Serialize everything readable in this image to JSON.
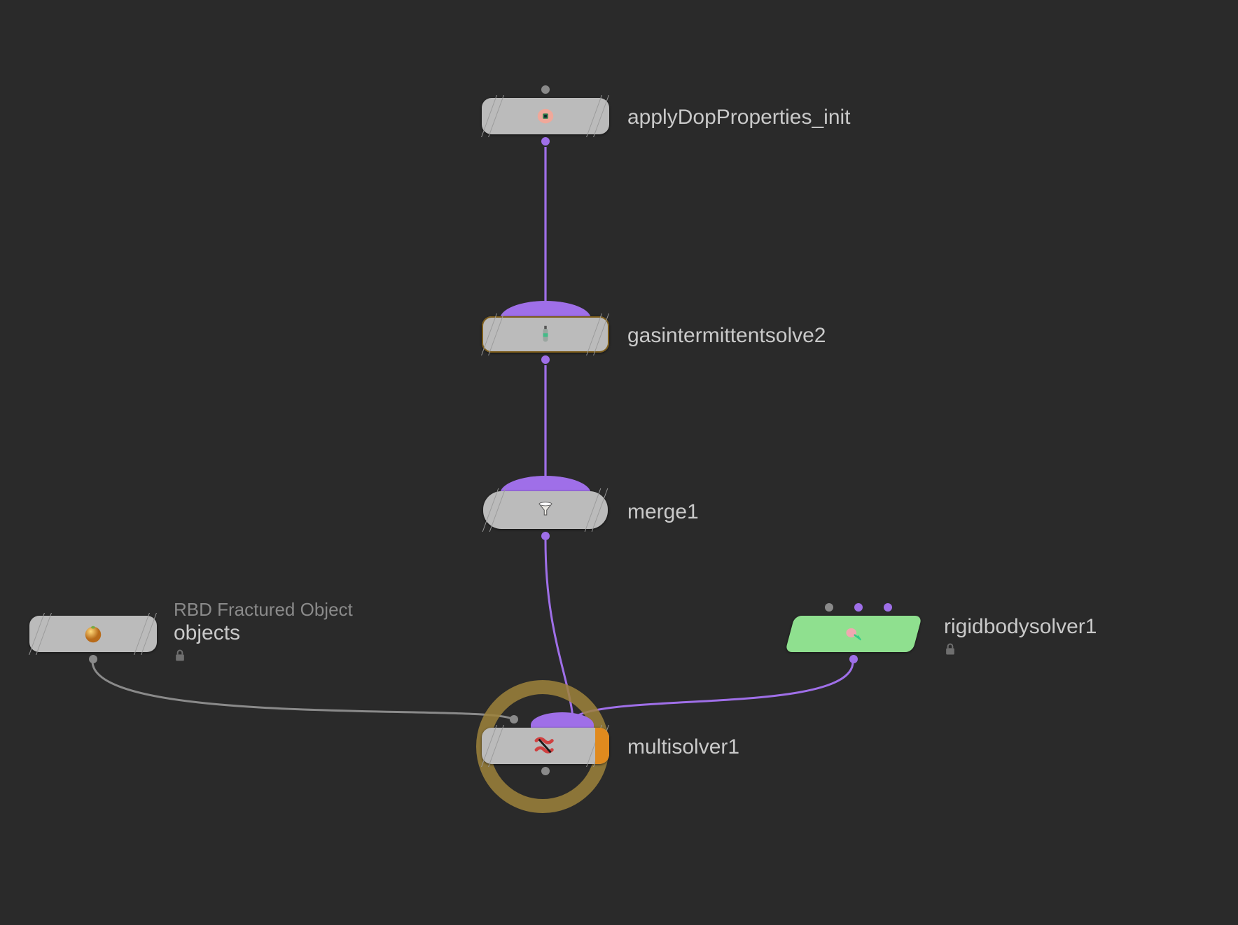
{
  "colors": {
    "background": "#2a2a2a",
    "wire_purple": "#9f6fe8",
    "wire_gray": "#8a8a8a",
    "ring": "#9e823b",
    "node_default": "#bbbbbb",
    "node_green": "#8fe08f",
    "flag_right": "#e08a1e"
  },
  "nodes": {
    "applydop": {
      "label": "applyDopProperties_init",
      "icon": "brain-icon"
    },
    "gassolve": {
      "label": "gasintermittentsolve2",
      "icon": "gas-tank-icon"
    },
    "merge": {
      "label": "merge1",
      "icon": "funnel-icon"
    },
    "objects": {
      "label": "objects",
      "comment": "RBD Fractured Object",
      "icon": "sphere-icon",
      "locked": true
    },
    "rbsolver": {
      "label": "rigidbodysolver1",
      "icon": "rbd-icon",
      "locked": true
    },
    "multisolver": {
      "label": "multisolver1",
      "icon": "multisolver-icon"
    }
  },
  "edges": [
    {
      "from": "applydop",
      "to": "gassolve",
      "color": "purple"
    },
    {
      "from": "gassolve",
      "to": "merge",
      "color": "purple"
    },
    {
      "from": "merge",
      "to": "multisolver",
      "color": "purple",
      "port": "sub"
    },
    {
      "from": "rbsolver",
      "to": "multisolver",
      "color": "purple",
      "port": "sub"
    },
    {
      "from": "objects",
      "to": "multisolver",
      "color": "gray",
      "port": "main"
    }
  ]
}
